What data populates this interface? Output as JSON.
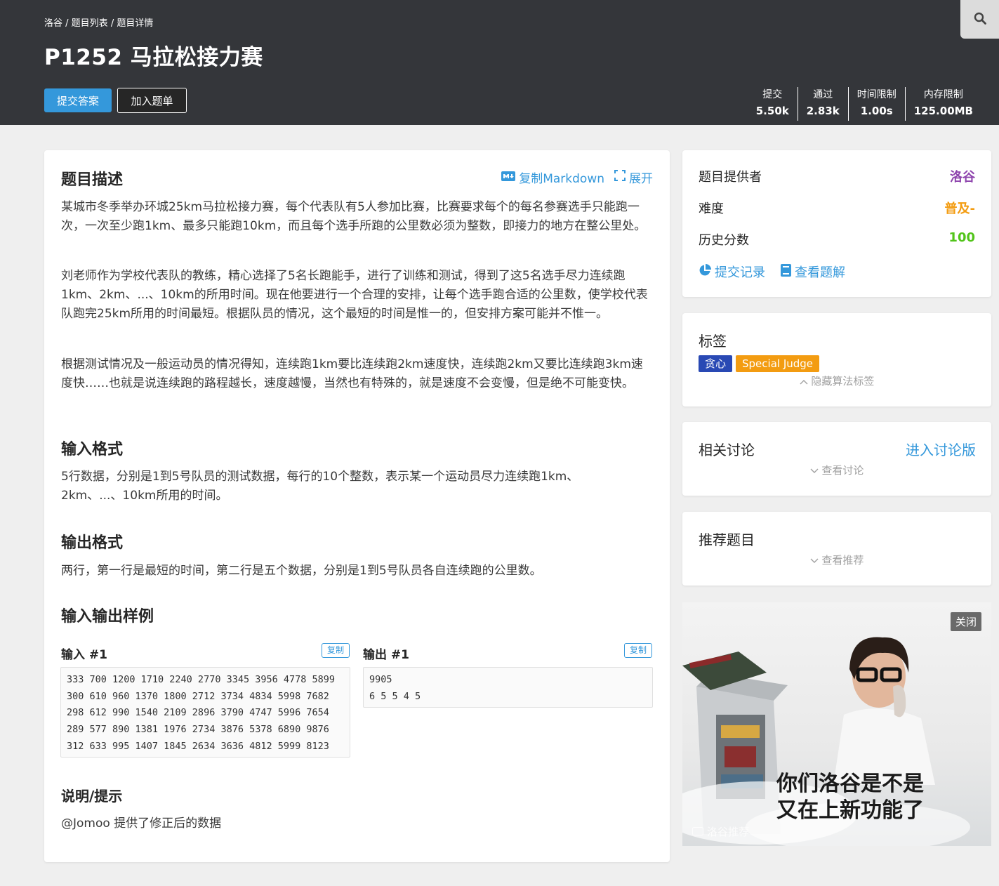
{
  "breadcrumb": {
    "home": "洛谷",
    "sep1": " / ",
    "list": "题目列表",
    "sep2": " / ",
    "detail": "题目详情"
  },
  "title": "P1252 马拉松接力赛",
  "actions": {
    "submit": "提交答案",
    "add_to_list": "加入题单"
  },
  "stats": [
    {
      "label": "提交",
      "value": "5.50k"
    },
    {
      "label": "通过",
      "value": "2.83k"
    },
    {
      "label": "时间限制",
      "value": "1.00s"
    },
    {
      "label": "内存限制",
      "value": "125.00MB"
    }
  ],
  "description": {
    "heading": "题目描述",
    "copy_markdown": "复制Markdown",
    "expand": "展开",
    "p1": "某城市冬季举办环城25km马拉松接力赛，每个代表队有5人参加比赛，比赛要求每个的每名参赛选手只能跑一次，一次至少跑1km、最多只能跑10km，而且每个选手所跑的公里数必须为整数，即接力的地方在整公里处。",
    "p2": "刘老师作为学校代表队的教练，精心选择了5名长跑能手，进行了训练和测试，得到了这5名选手尽力连续跑1km、2km、...、10km的所用时间。现在他要进行一个合理的安排，让每个选手跑合适的公里数，使学校代表队跑完25km所用的时间最短。根据队员的情况，这个最短的时间是惟一的，但安排方案可能并不惟一。",
    "p3": "根据测试情况及一般运动员的情况得知，连续跑1km要比连续跑2km速度快，连续跑2km又要比连续跑3km速度快……也就是说连续跑的路程越长，速度越慢，当然也有特殊的，就是速度不会变慢，但是绝不可能变快。"
  },
  "input_format": {
    "heading": "输入格式",
    "text": "5行数据，分别是1到5号队员的测试数据，每行的10个整数，表示某一个运动员尽力连续跑1km、2km、...、10km所用的时间。"
  },
  "output_format": {
    "heading": "输出格式",
    "text": "两行，第一行是最短的时间，第二行是五个数据，分别是1到5号队员各自连续跑的公里数。"
  },
  "samples": {
    "heading": "输入输出样例",
    "input_label": "输入 #1",
    "output_label": "输出 #1",
    "copy": "复制",
    "input": "333 700 1200 1710 2240 2770 3345 3956 4778 5899\n300 610 960 1370 1800 2712 3734 4834 5998 7682\n298 612 990 1540 2109 2896 3790 4747 5996 7654\n289 577 890 1381 1976 2734 3876 5378 6890 9876\n312 633 995 1407 1845 2634 3636 4812 5999 8123",
    "output": "9905\n6 5 5 4 5"
  },
  "hint": {
    "heading": "说明/提示",
    "text": "@Jomoo 提供了修正后的数据"
  },
  "info": {
    "provider_label": "题目提供者",
    "provider": "洛谷",
    "difficulty_label": "难度",
    "difficulty": "普及-",
    "score_label": "历史分数",
    "score": "100",
    "records": "提交记录",
    "solutions": "查看题解"
  },
  "tags": {
    "heading": "标签",
    "items": [
      "贪心",
      "Special Judge"
    ],
    "hide": "隐藏算法标签"
  },
  "discussion": {
    "heading": "相关讨论",
    "enter": "进入讨论版",
    "view": "查看讨论"
  },
  "recommend": {
    "heading": "推荐题目",
    "view": "查看推荐"
  },
  "ad": {
    "close": "关闭",
    "caption_line1": "你们洛谷是不是",
    "caption_line2": "又在上新功能了",
    "brand": "洛谷推荐"
  },
  "colors": {
    "header_bg": "#34363a",
    "accent": "#3498db",
    "provider": "#8e44ad",
    "difficulty": "#f39c11",
    "score": "#52c41a",
    "tag_greedy": "#2949b4",
    "tag_sj": "#f39c11"
  }
}
